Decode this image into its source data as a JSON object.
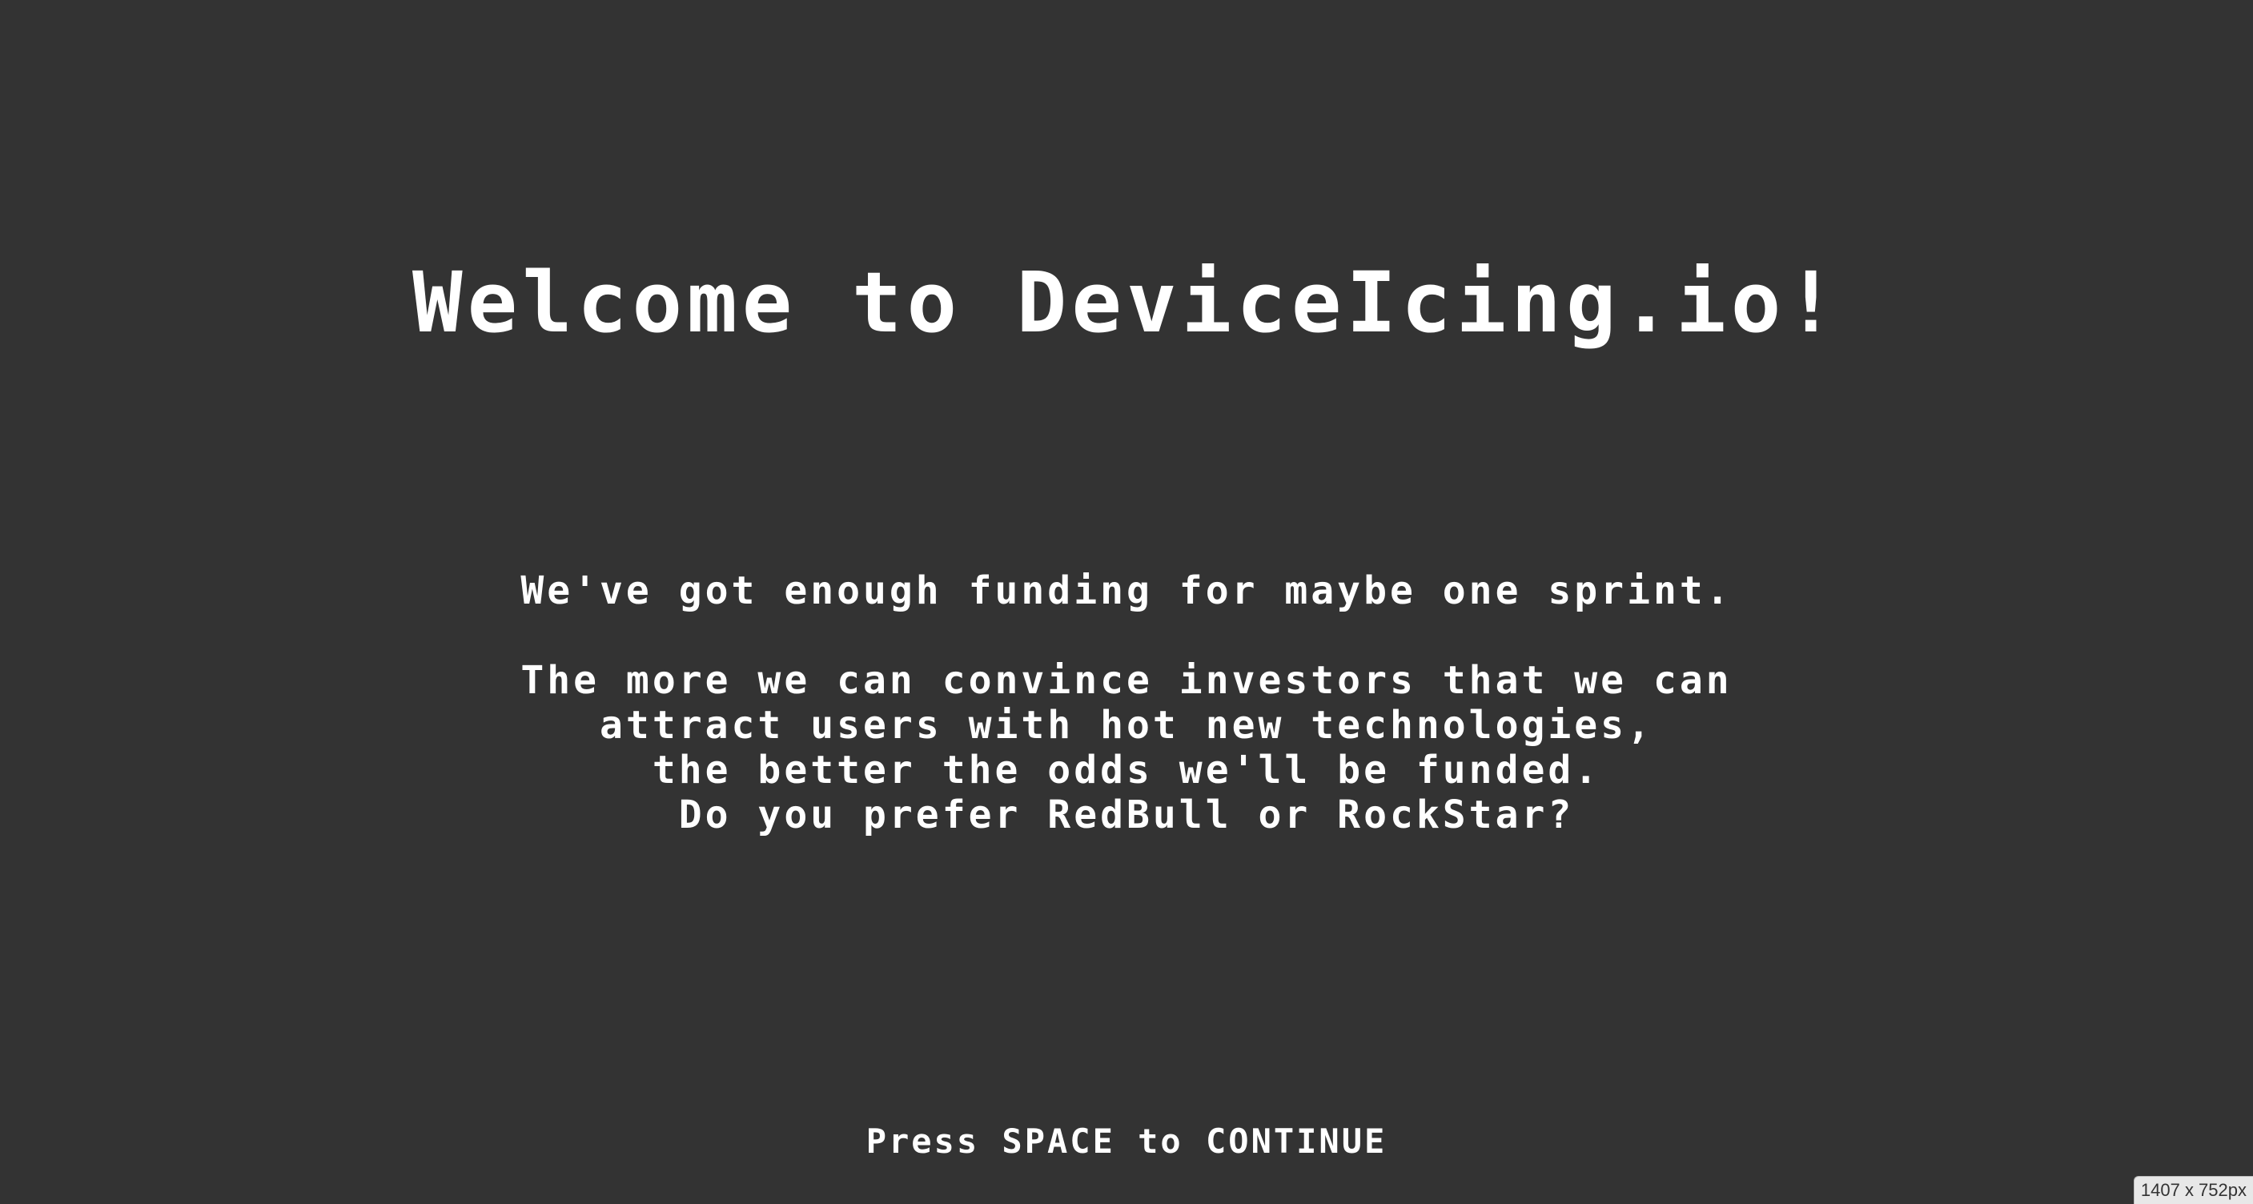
{
  "title": "Welcome to DeviceIcing.io!",
  "intro_lines": [
    "We've got enough funding for maybe one sprint.",
    "The more we can convince investors that we can",
    "attract users with hot new technologies,",
    "the better the odds we'll be funded.",
    "Do you prefer RedBull or RockStar?"
  ],
  "prompt": "Press SPACE to CONTINUE",
  "viewport_badge": "1407 x 752px",
  "colors": {
    "background": "#333333",
    "text": "#ffffff"
  }
}
